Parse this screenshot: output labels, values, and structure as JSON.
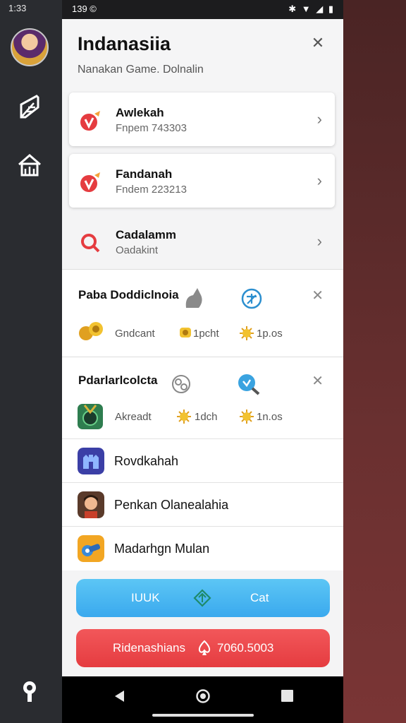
{
  "rail": {
    "time": "1:33"
  },
  "statusbar": {
    "time": "139 ©",
    "icons": "✱ ▼ ◢ ▮"
  },
  "header": {
    "title": "Indanasiia",
    "subtitle": "Nanakan Game. Dolnalin"
  },
  "cards": [
    {
      "title": "Awlekah",
      "subtitle": "Fnpem 743303"
    },
    {
      "title": "Fandanah",
      "subtitle": "Fndem 223213"
    },
    {
      "title": "Cadalamm",
      "subtitle": "Oadakint"
    }
  ],
  "sections": [
    {
      "title": "Paba Doddiclnoia",
      "stats": [
        "Gndcant",
        "1pcht",
        "1p.os"
      ]
    },
    {
      "title": "Pdarlarlcolcta",
      "stats": [
        "Akreadt",
        "1dch",
        "1n.os"
      ]
    }
  ],
  "rows": [
    {
      "label": "Rovdkahah"
    },
    {
      "label": "Penkan Olanealahia"
    },
    {
      "label": "Madarhgn Mulan"
    }
  ],
  "buttons": {
    "blue_left": "IUUK",
    "blue_right": "Cat",
    "red_left": "Ridenashians",
    "red_right": "7060.5003"
  },
  "colors": {
    "accent_blue": "#3aa9ee",
    "accent_red": "#e53c40",
    "rail": "#2a2c30"
  }
}
